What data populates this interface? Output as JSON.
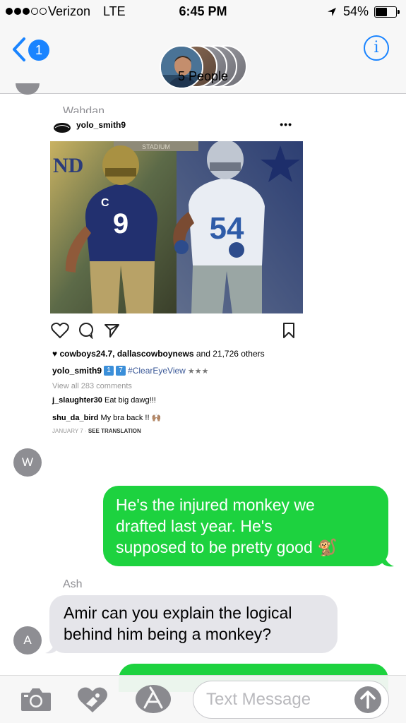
{
  "status_bar": {
    "carrier": "Verizon",
    "network": "LTE",
    "time": "6:45 PM",
    "battery": "54%",
    "battery_level": 0.54
  },
  "header": {
    "back_badge": "1",
    "title": "5 People",
    "info_icon": "i",
    "accent_color": "#1a84ff"
  },
  "messages": {
    "wahdan_sender": "Wahdan",
    "wahdan_initial": "W",
    "instagram": {
      "username": "yolo_smith9",
      "more": "•••",
      "jersey_left": "9",
      "jersey_right": "54",
      "likes_users": "cowboys24.7, dallascowboynews",
      "likes_rest": " and 21,726 others",
      "caption_user": "yolo_smith9",
      "caption_badges": [
        "1",
        "7"
      ],
      "caption_tag": "#ClearEyeView",
      "caption_stars": "★★★",
      "view_all": "View all 283 comments",
      "comment1_user": "j_slaughter30",
      "comment1_text": " Eat big dawg!!!",
      "comment2_user": "shu_da_bird",
      "comment2_text": " My bra back !! 🙌🏽",
      "date": "JANUARY 7 · ",
      "translation": "SEE TRANSLATION"
    },
    "out1_line1": "He's the injured monkey we",
    "out1_line2": "drafted last year. He's",
    "out1_line3": "supposed to be pretty good 🐒",
    "ash_sender": "Ash",
    "ash_initial": "A",
    "ash_line1": "Amir can you explain the logical",
    "ash_line2": "behind him being a monkey?",
    "outgoing_color": "#1dd23f",
    "incoming_color": "#e5e5ea"
  },
  "input_bar": {
    "placeholder": "Text Message",
    "icons": [
      "camera-icon",
      "digital-touch-heart-icon",
      "app-store-icon",
      "send-arrow-icon"
    ]
  }
}
